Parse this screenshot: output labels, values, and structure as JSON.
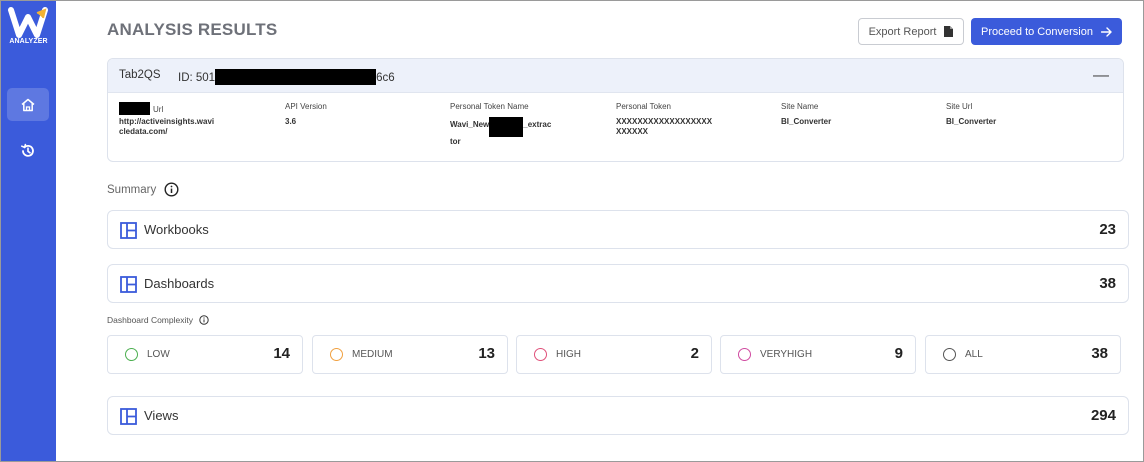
{
  "app": {
    "logo_text": "ANALYZER"
  },
  "header": {
    "title": "ANALYSIS RESULTS",
    "export_label": "Export Report",
    "proceed_label": "Proceed to Conversion"
  },
  "datasource": {
    "name": "Tab2QS",
    "id_prefix": "ID: 501",
    "id_suffix": "6c6",
    "collapse_symbol": "—",
    "columns": [
      {
        "label": "Url",
        "value": "http://activeinsights.wavi\ncledata.com/"
      },
      {
        "label": "API Version",
        "value": "3.6"
      },
      {
        "label": "Personal Token Name",
        "value_prefix": "Wavi_New",
        "value_suffix": "_extrac\ntor"
      },
      {
        "label": "Personal Token",
        "value": "XXXXXXXXXXXXXXXXXX\nXXXXXX"
      },
      {
        "label": "Site Name",
        "value": "BI_Converter"
      },
      {
        "label": "Site Url",
        "value": "BI_Converter"
      }
    ]
  },
  "summary": {
    "title": "Summary",
    "workbooks": {
      "label": "Workbooks",
      "count": "23"
    },
    "dashboards": {
      "label": "Dashboards",
      "count": "38"
    },
    "views": {
      "label": "Views",
      "count": "294"
    }
  },
  "complexity": {
    "title": "Dashboard Complexity",
    "items": [
      {
        "label": "LOW",
        "count": "14",
        "color": "#4caf50"
      },
      {
        "label": "MEDIUM",
        "count": "13",
        "color": "#f0a040"
      },
      {
        "label": "HIGH",
        "count": "2",
        "color": "#e0507a"
      },
      {
        "label": "VERYHIGH",
        "count": "9",
        "color": "#d04aa0"
      },
      {
        "label": "ALL",
        "count": "38",
        "color": "#555555"
      }
    ]
  },
  "colors": {
    "brand": "#3b5bdb",
    "panel_header": "#edf1fa"
  }
}
